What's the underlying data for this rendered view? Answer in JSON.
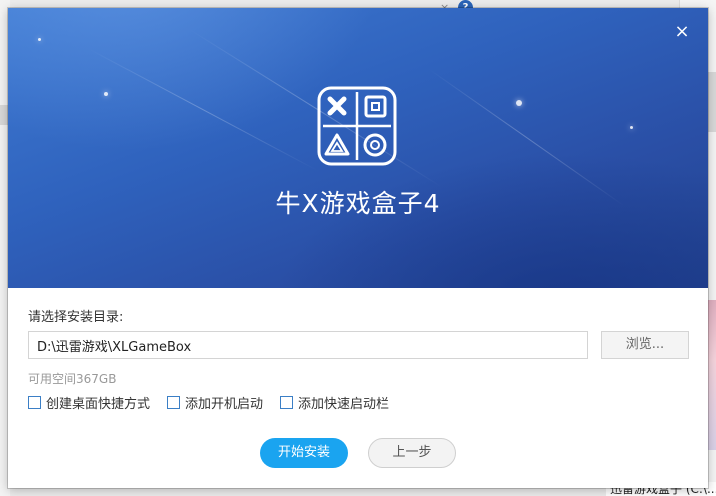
{
  "background": {
    "help_glyph": "?",
    "close_glyph": "×",
    "taskbar_text": "迅雷游戏盒子 (C:\\..."
  },
  "dialog": {
    "close_glyph": "×",
    "app_title": "牛X游戏盒子4",
    "logo_icon": "game-controller-symbols-icon",
    "install_dir_label": "请选择安装目录:",
    "install_path_value": "D:\\迅雷游戏\\XLGameBox",
    "browse_label": "浏览...",
    "free_space_text": "可用空间367GB",
    "checkboxes": [
      {
        "label": "创建桌面快捷方式",
        "checked": false
      },
      {
        "label": "添加开机启动",
        "checked": false
      },
      {
        "label": "添加快速启动栏",
        "checked": false
      }
    ],
    "start_install_label": "开始安装",
    "prev_step_label": "上一步",
    "colors": {
      "banner_top": "#3f7bd3",
      "banner_bottom": "#23428f",
      "primary_button": "#1aa4f0",
      "checkbox_border": "#3b7fc6"
    }
  }
}
